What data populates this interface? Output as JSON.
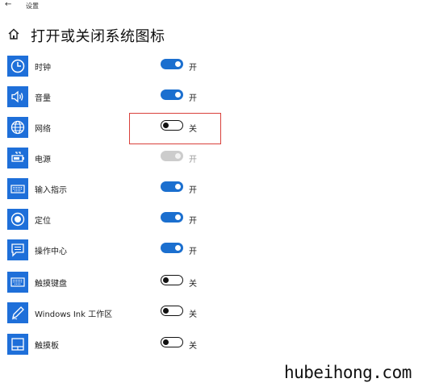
{
  "window": {
    "back_glyph": "←",
    "app_title": "设置"
  },
  "page": {
    "title": "打开或关闭系统图标"
  },
  "items": [
    {
      "icon": "clock-icon",
      "label": "时钟",
      "state": "on",
      "state_label": "开"
    },
    {
      "icon": "volume-icon",
      "label": "音量",
      "state": "on",
      "state_label": "开"
    },
    {
      "icon": "network-icon",
      "label": "网络",
      "state": "off",
      "state_label": "关"
    },
    {
      "icon": "battery-icon",
      "label": "电源",
      "state": "disabled",
      "state_label": "开"
    },
    {
      "icon": "keyboard-icon",
      "label": "输入指示",
      "state": "on",
      "state_label": "开"
    },
    {
      "icon": "location-icon",
      "label": "定位",
      "state": "on",
      "state_label": "开"
    },
    {
      "icon": "action-center-icon",
      "label": "操作中心",
      "state": "on",
      "state_label": "开"
    },
    {
      "icon": "touch-keyboard-icon",
      "label": "触摸键盘",
      "state": "off",
      "state_label": "关"
    },
    {
      "icon": "pen-icon",
      "label": "Windows Ink 工作区",
      "state": "off",
      "state_label": "关"
    },
    {
      "icon": "touchpad-icon",
      "label": "触摸板",
      "state": "off",
      "state_label": "关"
    }
  ],
  "watermark": "hubeihong.com",
  "colors": {
    "accent": "#1e6fd9",
    "toggle_on": "#1b6fcf",
    "highlight": "#d9403b",
    "disabled": "#cccccc"
  }
}
